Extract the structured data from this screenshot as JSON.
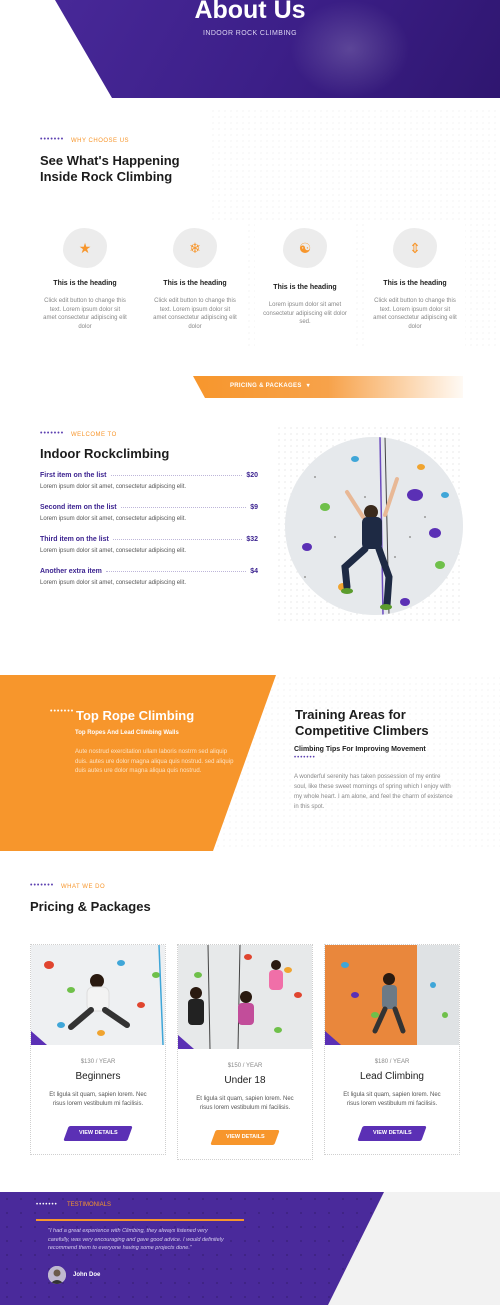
{
  "hero": {
    "title": "About Us",
    "subtitle": "INDOOR ROCK CLIMBING"
  },
  "why": {
    "eyebrow_dots": "•••••••",
    "eyebrow": "WHY CHOOSE US",
    "title_line1": "See What's Happening",
    "title_line2": "Inside Rock Climbing",
    "cards": [
      {
        "icon": "trophy-icon",
        "glyph": "🏆",
        "heading": "This is the heading",
        "text": "Click edit button to change this text. Lorem ipsum dolor sit amet consectetur adipiscing elit dolor"
      },
      {
        "icon": "snowflake-icon",
        "glyph": "❄",
        "heading": "This is the heading",
        "text": "Click edit button to change this text. Lorem ipsum dolor sit amet consectetur adipiscing elit dolor"
      },
      {
        "icon": "climber-icon",
        "glyph": "🧍",
        "heading": "This is the heading",
        "text": "Lorem ipsum dolor sit amet consectetur adipiscing elit dolor sed."
      },
      {
        "icon": "arrows-icon",
        "glyph": "⬍",
        "heading": "This is the heading",
        "text": "Click edit button to change this text. Lorem ipsum dolor sit amet consectetur adipiscing elit dolor"
      }
    ]
  },
  "pricing_tab": {
    "label": "PRICING & PACKAGES",
    "chevron": "▾"
  },
  "welcome": {
    "eyebrow_dots": "•••••••",
    "eyebrow": "WELCOME TO",
    "title": "Indoor Rockclimbing",
    "items": [
      {
        "name": "First item on the list",
        "price": "$20",
        "desc": "Lorem ipsum dolor sit amet, consectetur adipiscing elit."
      },
      {
        "name": "Second item on the list",
        "price": "$9",
        "desc": "Lorem ipsum dolor sit amet, consectetur adipiscing elit."
      },
      {
        "name": "Third item on the list",
        "price": "$32",
        "desc": "Lorem ipsum dolor sit amet, consectetur adipiscing elit."
      },
      {
        "name": "Another extra item",
        "price": "$4",
        "desc": "Lorem ipsum dolor sit amet, consectetur adipiscing elit."
      }
    ]
  },
  "top_rope": {
    "dots": "•••••••",
    "title": "Top Rope Climbing",
    "subtitle": "Top Ropes And Lead Climbing Walls",
    "body": "Aute nostrud exercitation ullam laboris nostrm sed aliquip duis. autes ure dolor magna aliqua quis nostrud. sed aliquip duis autes ure dolor magna aliqua quis nostrud."
  },
  "training": {
    "title": "Training Areas for Competitive Climbers",
    "subtitle": "Climbing Tips For Improving Movement",
    "dots": "•••••••",
    "body": "A wonderful serenity has taken possession of my entire soul, like these sweet mornings of spring which I enjoy with my whole heart. I am alone, and feel the charm of existence in this spot."
  },
  "packages": {
    "eyebrow_dots": "•••••••",
    "eyebrow": "WHAT WE DO",
    "title": "Pricing & Packages",
    "cards": [
      {
        "price": "$130 / YEAR",
        "name": "Beginners",
        "desc": "Et ligula sit quam, sapien lorem. Nec risus lorem vestibulum mi facilisis.",
        "button": "VIEW DETAILS",
        "button_color": "#5b30b5"
      },
      {
        "price": "$150 / YEAR",
        "name": "Under 18",
        "desc": "Et ligula sit quam, sapien lorem. Nec risus lorem vestibulum mi facilisis.",
        "button": "VIEW DETAILS",
        "button_color": "#f7962c"
      },
      {
        "price": "$180 / YEAR",
        "name": "Lead Climbing",
        "desc": "Et ligula sit quam, sapien lorem. Nec risus lorem vestibulum mi facilisis.",
        "button": "VIEW DETAILS",
        "button_color": "#5b30b5"
      }
    ]
  },
  "testimonials": {
    "eyebrow_dots": "•••••••",
    "eyebrow": "TESTIMONIALS",
    "quote": "\"I had a great experience with Climbing, they always listened very carefully, was very encouraging and gave good advice. I would definitely recommend them to everyone having some projects done.\"",
    "name": "John Doe"
  },
  "colors": {
    "purple": "#4a2a9b",
    "orange": "#f7962c",
    "accent_purple": "#5b30b5"
  }
}
